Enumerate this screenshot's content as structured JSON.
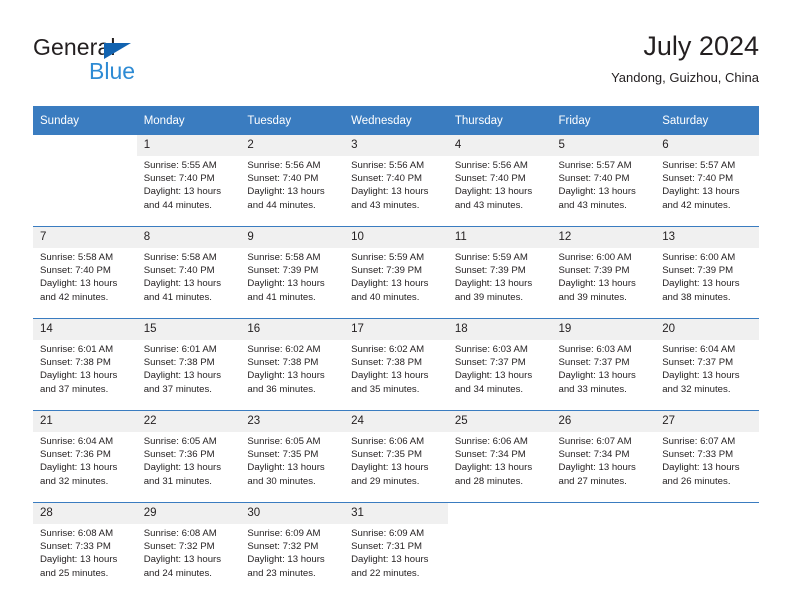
{
  "brand": {
    "name_part1": "General",
    "name_part2": "Blue",
    "triangle_color": "#1263b0",
    "blue_color": "#2e8bd4"
  },
  "header": {
    "title": "July 2024",
    "location": "Yandong, Guizhou, China"
  },
  "theme": {
    "header_bg": "#3a7cc0",
    "daynum_bg": "#f0f0f0",
    "text": "#231f20",
    "grid_line": "#3a7cc0"
  },
  "weekday_headers": [
    "Sunday",
    "Monday",
    "Tuesday",
    "Wednesday",
    "Thursday",
    "Friday",
    "Saturday"
  ],
  "weeks": [
    [
      {
        "day": "",
        "sunrise": "",
        "sunset": "",
        "daylight1": "",
        "daylight2": ""
      },
      {
        "day": "1",
        "sunrise": "Sunrise: 5:55 AM",
        "sunset": "Sunset: 7:40 PM",
        "daylight1": "Daylight: 13 hours",
        "daylight2": "and 44 minutes."
      },
      {
        "day": "2",
        "sunrise": "Sunrise: 5:56 AM",
        "sunset": "Sunset: 7:40 PM",
        "daylight1": "Daylight: 13 hours",
        "daylight2": "and 44 minutes."
      },
      {
        "day": "3",
        "sunrise": "Sunrise: 5:56 AM",
        "sunset": "Sunset: 7:40 PM",
        "daylight1": "Daylight: 13 hours",
        "daylight2": "and 43 minutes."
      },
      {
        "day": "4",
        "sunrise": "Sunrise: 5:56 AM",
        "sunset": "Sunset: 7:40 PM",
        "daylight1": "Daylight: 13 hours",
        "daylight2": "and 43 minutes."
      },
      {
        "day": "5",
        "sunrise": "Sunrise: 5:57 AM",
        "sunset": "Sunset: 7:40 PM",
        "daylight1": "Daylight: 13 hours",
        "daylight2": "and 43 minutes."
      },
      {
        "day": "6",
        "sunrise": "Sunrise: 5:57 AM",
        "sunset": "Sunset: 7:40 PM",
        "daylight1": "Daylight: 13 hours",
        "daylight2": "and 42 minutes."
      }
    ],
    [
      {
        "day": "7",
        "sunrise": "Sunrise: 5:58 AM",
        "sunset": "Sunset: 7:40 PM",
        "daylight1": "Daylight: 13 hours",
        "daylight2": "and 42 minutes."
      },
      {
        "day": "8",
        "sunrise": "Sunrise: 5:58 AM",
        "sunset": "Sunset: 7:40 PM",
        "daylight1": "Daylight: 13 hours",
        "daylight2": "and 41 minutes."
      },
      {
        "day": "9",
        "sunrise": "Sunrise: 5:58 AM",
        "sunset": "Sunset: 7:39 PM",
        "daylight1": "Daylight: 13 hours",
        "daylight2": "and 41 minutes."
      },
      {
        "day": "10",
        "sunrise": "Sunrise: 5:59 AM",
        "sunset": "Sunset: 7:39 PM",
        "daylight1": "Daylight: 13 hours",
        "daylight2": "and 40 minutes."
      },
      {
        "day": "11",
        "sunrise": "Sunrise: 5:59 AM",
        "sunset": "Sunset: 7:39 PM",
        "daylight1": "Daylight: 13 hours",
        "daylight2": "and 39 minutes."
      },
      {
        "day": "12",
        "sunrise": "Sunrise: 6:00 AM",
        "sunset": "Sunset: 7:39 PM",
        "daylight1": "Daylight: 13 hours",
        "daylight2": "and 39 minutes."
      },
      {
        "day": "13",
        "sunrise": "Sunrise: 6:00 AM",
        "sunset": "Sunset: 7:39 PM",
        "daylight1": "Daylight: 13 hours",
        "daylight2": "and 38 minutes."
      }
    ],
    [
      {
        "day": "14",
        "sunrise": "Sunrise: 6:01 AM",
        "sunset": "Sunset: 7:38 PM",
        "daylight1": "Daylight: 13 hours",
        "daylight2": "and 37 minutes."
      },
      {
        "day": "15",
        "sunrise": "Sunrise: 6:01 AM",
        "sunset": "Sunset: 7:38 PM",
        "daylight1": "Daylight: 13 hours",
        "daylight2": "and 37 minutes."
      },
      {
        "day": "16",
        "sunrise": "Sunrise: 6:02 AM",
        "sunset": "Sunset: 7:38 PM",
        "daylight1": "Daylight: 13 hours",
        "daylight2": "and 36 minutes."
      },
      {
        "day": "17",
        "sunrise": "Sunrise: 6:02 AM",
        "sunset": "Sunset: 7:38 PM",
        "daylight1": "Daylight: 13 hours",
        "daylight2": "and 35 minutes."
      },
      {
        "day": "18",
        "sunrise": "Sunrise: 6:03 AM",
        "sunset": "Sunset: 7:37 PM",
        "daylight1": "Daylight: 13 hours",
        "daylight2": "and 34 minutes."
      },
      {
        "day": "19",
        "sunrise": "Sunrise: 6:03 AM",
        "sunset": "Sunset: 7:37 PM",
        "daylight1": "Daylight: 13 hours",
        "daylight2": "and 33 minutes."
      },
      {
        "day": "20",
        "sunrise": "Sunrise: 6:04 AM",
        "sunset": "Sunset: 7:37 PM",
        "daylight1": "Daylight: 13 hours",
        "daylight2": "and 32 minutes."
      }
    ],
    [
      {
        "day": "21",
        "sunrise": "Sunrise: 6:04 AM",
        "sunset": "Sunset: 7:36 PM",
        "daylight1": "Daylight: 13 hours",
        "daylight2": "and 32 minutes."
      },
      {
        "day": "22",
        "sunrise": "Sunrise: 6:05 AM",
        "sunset": "Sunset: 7:36 PM",
        "daylight1": "Daylight: 13 hours",
        "daylight2": "and 31 minutes."
      },
      {
        "day": "23",
        "sunrise": "Sunrise: 6:05 AM",
        "sunset": "Sunset: 7:35 PM",
        "daylight1": "Daylight: 13 hours",
        "daylight2": "and 30 minutes."
      },
      {
        "day": "24",
        "sunrise": "Sunrise: 6:06 AM",
        "sunset": "Sunset: 7:35 PM",
        "daylight1": "Daylight: 13 hours",
        "daylight2": "and 29 minutes."
      },
      {
        "day": "25",
        "sunrise": "Sunrise: 6:06 AM",
        "sunset": "Sunset: 7:34 PM",
        "daylight1": "Daylight: 13 hours",
        "daylight2": "and 28 minutes."
      },
      {
        "day": "26",
        "sunrise": "Sunrise: 6:07 AM",
        "sunset": "Sunset: 7:34 PM",
        "daylight1": "Daylight: 13 hours",
        "daylight2": "and 27 minutes."
      },
      {
        "day": "27",
        "sunrise": "Sunrise: 6:07 AM",
        "sunset": "Sunset: 7:33 PM",
        "daylight1": "Daylight: 13 hours",
        "daylight2": "and 26 minutes."
      }
    ],
    [
      {
        "day": "28",
        "sunrise": "Sunrise: 6:08 AM",
        "sunset": "Sunset: 7:33 PM",
        "daylight1": "Daylight: 13 hours",
        "daylight2": "and 25 minutes."
      },
      {
        "day": "29",
        "sunrise": "Sunrise: 6:08 AM",
        "sunset": "Sunset: 7:32 PM",
        "daylight1": "Daylight: 13 hours",
        "daylight2": "and 24 minutes."
      },
      {
        "day": "30",
        "sunrise": "Sunrise: 6:09 AM",
        "sunset": "Sunset: 7:32 PM",
        "daylight1": "Daylight: 13 hours",
        "daylight2": "and 23 minutes."
      },
      {
        "day": "31",
        "sunrise": "Sunrise: 6:09 AM",
        "sunset": "Sunset: 7:31 PM",
        "daylight1": "Daylight: 13 hours",
        "daylight2": "and 22 minutes."
      },
      {
        "day": "",
        "sunrise": "",
        "sunset": "",
        "daylight1": "",
        "daylight2": ""
      },
      {
        "day": "",
        "sunrise": "",
        "sunset": "",
        "daylight1": "",
        "daylight2": ""
      },
      {
        "day": "",
        "sunrise": "",
        "sunset": "",
        "daylight1": "",
        "daylight2": ""
      }
    ]
  ]
}
